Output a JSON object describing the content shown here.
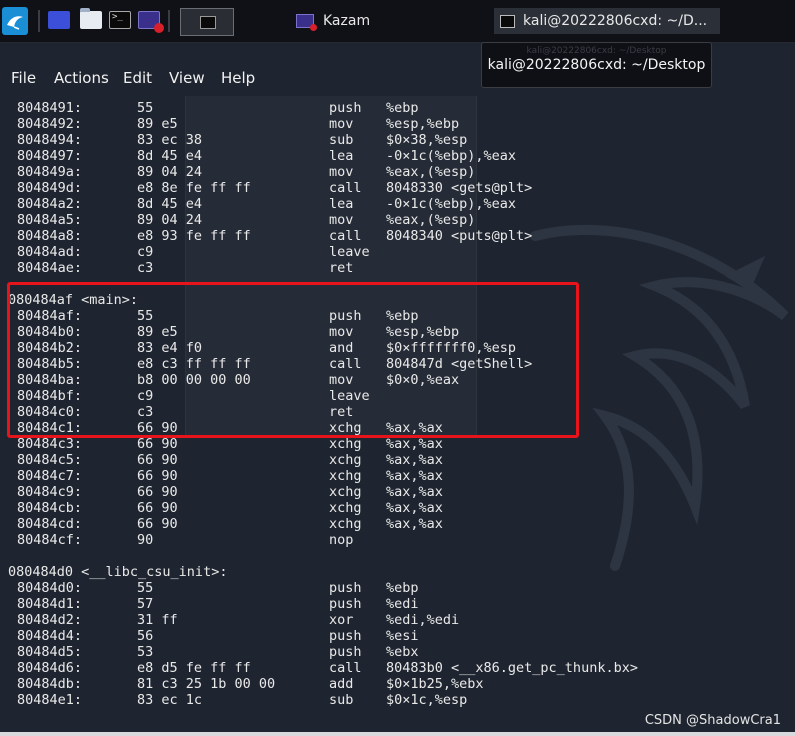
{
  "taskbar": {
    "windows": [
      {
        "title": "Kazam"
      },
      {
        "title": "kali@20222806cxd: ~/D..."
      }
    ]
  },
  "menu": [
    "File",
    "Actions",
    "Edit",
    "View",
    "Help"
  ],
  "tooltip": {
    "text": "kali@20222806cxd: ~/Desktop",
    "ghost": "kali@20222806cxd: ~/Desktop"
  },
  "disassembly": [
    {
      "type": "ins",
      "addr": "8048491:",
      "bytes": "55",
      "mnemonic": "push",
      "operands": "%ebp"
    },
    {
      "type": "ins",
      "addr": "8048492:",
      "bytes": "89 e5",
      "mnemonic": "mov",
      "operands": "%esp,%ebp"
    },
    {
      "type": "ins",
      "addr": "8048494:",
      "bytes": "83 ec 38",
      "mnemonic": "sub",
      "operands": "$0×38,%esp"
    },
    {
      "type": "ins",
      "addr": "8048497:",
      "bytes": "8d 45 e4",
      "mnemonic": "lea",
      "operands": "-0×1c(%ebp),%eax"
    },
    {
      "type": "ins",
      "addr": "804849a:",
      "bytes": "89 04 24",
      "mnemonic": "mov",
      "operands": "%eax,(%esp)"
    },
    {
      "type": "ins",
      "addr": "804849d:",
      "bytes": "e8 8e fe ff ff",
      "mnemonic": "call",
      "operands": "8048330 <gets@plt>"
    },
    {
      "type": "ins",
      "addr": "80484a2:",
      "bytes": "8d 45 e4",
      "mnemonic": "lea",
      "operands": "-0×1c(%ebp),%eax"
    },
    {
      "type": "ins",
      "addr": "80484a5:",
      "bytes": "89 04 24",
      "mnemonic": "mov",
      "operands": "%eax,(%esp)"
    },
    {
      "type": "ins",
      "addr": "80484a8:",
      "bytes": "e8 93 fe ff ff",
      "mnemonic": "call",
      "operands": "8048340 <puts@plt>"
    },
    {
      "type": "ins",
      "addr": "80484ad:",
      "bytes": "c9",
      "mnemonic": "leave",
      "operands": ""
    },
    {
      "type": "ins",
      "addr": "80484ae:",
      "bytes": "c3",
      "mnemonic": "ret",
      "operands": ""
    },
    {
      "type": "blank"
    },
    {
      "type": "label",
      "text": "080484af <main>:"
    },
    {
      "type": "ins",
      "addr": "80484af:",
      "bytes": "55",
      "mnemonic": "push",
      "operands": "%ebp"
    },
    {
      "type": "ins",
      "addr": "80484b0:",
      "bytes": "89 e5",
      "mnemonic": "mov",
      "operands": "%esp,%ebp"
    },
    {
      "type": "ins",
      "addr": "80484b2:",
      "bytes": "83 e4 f0",
      "mnemonic": "and",
      "operands": "$0×fffffff0,%esp"
    },
    {
      "type": "ins",
      "addr": "80484b5:",
      "bytes": "e8 c3 ff ff ff",
      "mnemonic": "call",
      "operands": "804847d <getShell>"
    },
    {
      "type": "ins",
      "addr": "80484ba:",
      "bytes": "b8 00 00 00 00",
      "mnemonic": "mov",
      "operands": "$0×0,%eax"
    },
    {
      "type": "ins",
      "addr": "80484bf:",
      "bytes": "c9",
      "mnemonic": "leave",
      "operands": ""
    },
    {
      "type": "ins",
      "addr": "80484c0:",
      "bytes": "c3",
      "mnemonic": "ret",
      "operands": ""
    },
    {
      "type": "ins",
      "addr": "80484c1:",
      "bytes": "66 90",
      "mnemonic": "xchg",
      "operands": "%ax,%ax"
    },
    {
      "type": "ins",
      "addr": "80484c3:",
      "bytes": "66 90",
      "mnemonic": "xchg",
      "operands": "%ax,%ax"
    },
    {
      "type": "ins",
      "addr": "80484c5:",
      "bytes": "66 90",
      "mnemonic": "xchg",
      "operands": "%ax,%ax"
    },
    {
      "type": "ins",
      "addr": "80484c7:",
      "bytes": "66 90",
      "mnemonic": "xchg",
      "operands": "%ax,%ax"
    },
    {
      "type": "ins",
      "addr": "80484c9:",
      "bytes": "66 90",
      "mnemonic": "xchg",
      "operands": "%ax,%ax"
    },
    {
      "type": "ins",
      "addr": "80484cb:",
      "bytes": "66 90",
      "mnemonic": "xchg",
      "operands": "%ax,%ax"
    },
    {
      "type": "ins",
      "addr": "80484cd:",
      "bytes": "66 90",
      "mnemonic": "xchg",
      "operands": "%ax,%ax"
    },
    {
      "type": "ins",
      "addr": "80484cf:",
      "bytes": "90",
      "mnemonic": "nop",
      "operands": ""
    },
    {
      "type": "blank"
    },
    {
      "type": "label",
      "text": "080484d0 <__libc_csu_init>:"
    },
    {
      "type": "ins",
      "addr": "80484d0:",
      "bytes": "55",
      "mnemonic": "push",
      "operands": "%ebp"
    },
    {
      "type": "ins",
      "addr": "80484d1:",
      "bytes": "57",
      "mnemonic": "push",
      "operands": "%edi"
    },
    {
      "type": "ins",
      "addr": "80484d2:",
      "bytes": "31 ff",
      "mnemonic": "xor",
      "operands": "%edi,%edi"
    },
    {
      "type": "ins",
      "addr": "80484d4:",
      "bytes": "56",
      "mnemonic": "push",
      "operands": "%esi"
    },
    {
      "type": "ins",
      "addr": "80484d5:",
      "bytes": "53",
      "mnemonic": "push",
      "operands": "%ebx"
    },
    {
      "type": "ins",
      "addr": "80484d6:",
      "bytes": "e8 d5 fe ff ff",
      "mnemonic": "call",
      "operands": "80483b0 <__x86.get_pc_thunk.bx>"
    },
    {
      "type": "ins",
      "addr": "80484db:",
      "bytes": "81 c3 25 1b 00 00",
      "mnemonic": "add",
      "operands": "$0×1b25,%ebx"
    },
    {
      "type": "ins",
      "addr": "80484e1:",
      "bytes": "83 ec 1c",
      "mnemonic": "sub",
      "operands": "$0×1c,%esp"
    }
  ],
  "watermark": "CSDN @ShadowCra1",
  "colors": {
    "background": "#1f2530",
    "highlight": "#e8141b",
    "text": "#e9e9e9"
  }
}
